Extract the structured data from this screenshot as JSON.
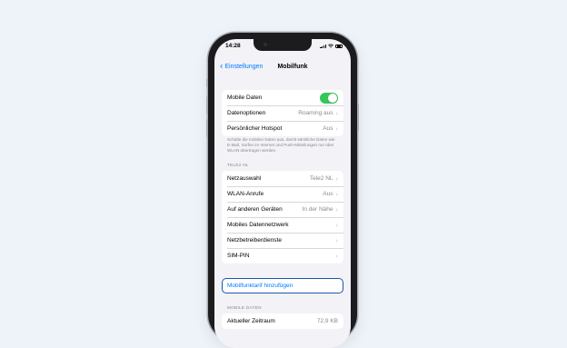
{
  "status_bar": {
    "time": "14:28"
  },
  "nav": {
    "back_label": "Einstellungen",
    "title": "Mobilfunk"
  },
  "group_main": [
    {
      "label": "Mobile Daten",
      "toggle_on": true
    },
    {
      "label": "Datenoptionen",
      "value": "Roaming aus"
    },
    {
      "label": "Persönlicher Hotspot",
      "value": "Aus"
    }
  ],
  "footer_note": "Schalte die mobilen Daten aus, damit sämtliche Daten wie E-Mail, Surfen im Internet und Push-Mitteilungen nur über WLAN übertragen werden.",
  "carrier_section": {
    "header": "TELE2 NL",
    "rows": [
      {
        "label": "Netzauswahl",
        "value": "Tele2 NL"
      },
      {
        "label": "WLAN-Anrufe",
        "value": "Aus"
      },
      {
        "label": "Auf anderen Geräten",
        "value": "In der Nähe"
      },
      {
        "label": "Mobiles Datennetzwerk",
        "value": ""
      },
      {
        "label": "Netzbetreiberdienste",
        "value": ""
      },
      {
        "label": "SIM-PIN",
        "value": ""
      }
    ]
  },
  "add_plan_label": "Mobilfunktarif hinzufügen",
  "mobile_data_section": {
    "header": "MOBILE DATEN",
    "rows": [
      {
        "label": "Aktueller Zeitraum",
        "value": "72,9 KB"
      }
    ]
  },
  "colors": {
    "accent": "#007aff",
    "toggle_on": "#34c759",
    "focus_outline": "#1a58a6",
    "background": "#eef3f9"
  }
}
